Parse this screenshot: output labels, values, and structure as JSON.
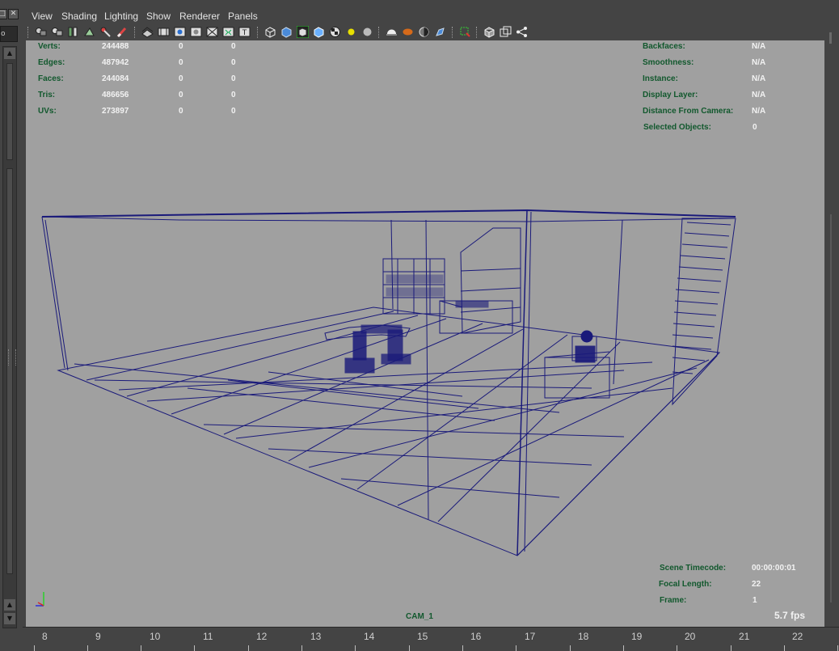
{
  "window": {
    "minimize_glyph": "□",
    "close_glyph": "✕",
    "left_field_text": "o"
  },
  "menu": [
    "View",
    "Shading",
    "Lighting",
    "Show",
    "Renderer",
    "Panels"
  ],
  "toolbar_icons": [
    "camera-attributes-icon",
    "bookmark-camera-icon",
    "image-plane-icon",
    "2d-pan-zoom-icon",
    "grease-pencil-icon",
    "grease-pencil-2-icon",
    "grid-icon",
    "film-gate-icon",
    "resolution-gate-icon",
    "gate-mask-icon",
    "field-chart-icon",
    "safe-action-icon",
    "safe-title-icon",
    "wireframe-icon",
    "smooth-shade-icon",
    "wireframe-on-shaded-icon",
    "textured-icon",
    "use-all-lights-icon",
    "shadows-icon",
    "screen-space-ao-icon",
    "motion-blur-icon",
    "multisample-aa-icon",
    "depth-of-field-icon",
    "isolate-select-icon",
    "xray-icon",
    "xray-active-components-icon",
    "xray-joints-icon"
  ],
  "hud_left": [
    {
      "label": "Verts:",
      "v1": "244488",
      "v2": "0",
      "v3": "0"
    },
    {
      "label": "Edges:",
      "v1": "487942",
      "v2": "0",
      "v3": "0"
    },
    {
      "label": "Faces:",
      "v1": "244084",
      "v2": "0",
      "v3": "0"
    },
    {
      "label": "Tris:",
      "v1": "486656",
      "v2": "0",
      "v3": "0"
    },
    {
      "label": "UVs:",
      "v1": "273897",
      "v2": "0",
      "v3": "0"
    }
  ],
  "hud_right": [
    {
      "label": "Backfaces:",
      "value": "N/A"
    },
    {
      "label": "Smoothness:",
      "value": "N/A"
    },
    {
      "label": "Instance:",
      "value": "N/A"
    },
    {
      "label": "Display Layer:",
      "value": "N/A"
    },
    {
      "label": "Distance From Camera:",
      "value": "N/A"
    },
    {
      "label": "Selected Objects:",
      "value": "0"
    }
  ],
  "hud_bottom": [
    {
      "label": "Scene Timecode:",
      "value": "00:00:00:01"
    },
    {
      "label": "Focal Length:",
      "value": "22"
    },
    {
      "label": "Frame:",
      "value": "1"
    }
  ],
  "camera_label": "CAM_1",
  "fps": "5.7 fps",
  "ruler": [
    "8",
    "9",
    "10",
    "11",
    "12",
    "13",
    "14",
    "15",
    "16",
    "17",
    "18",
    "19",
    "20",
    "21",
    "22"
  ],
  "colors": {
    "viewport_bg": "#a0a0a0",
    "wireframe": "#1a1a7a",
    "hud_label": "#11582d",
    "hud_value": "#f2f2f2",
    "ui_bg": "#444444"
  }
}
